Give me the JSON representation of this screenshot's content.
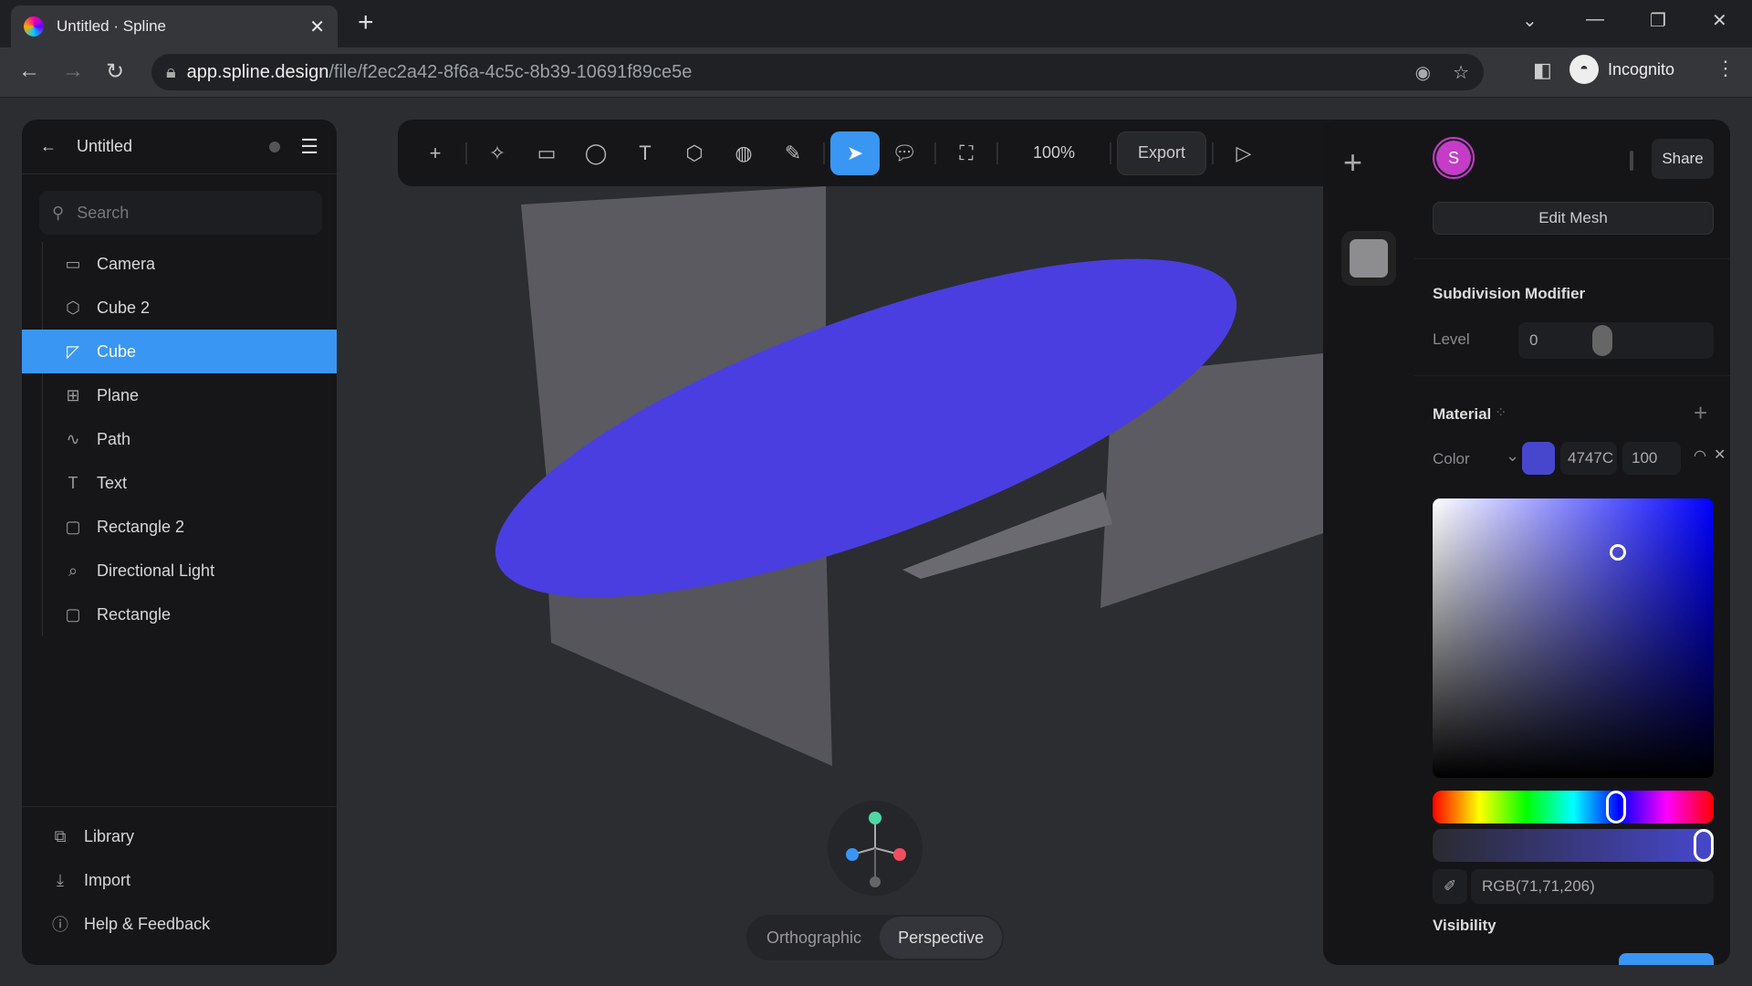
{
  "browser": {
    "tab_title": "Untitled · Spline",
    "url_host": "app.spline.design",
    "url_path": "/file/f2ec2a42-8f6a-4c5c-8b39-10691f89ce5e",
    "profile": "Incognito"
  },
  "left_panel": {
    "title": "Untitled",
    "search_placeholder": "Search",
    "items": [
      {
        "label": "Camera",
        "icon": "camera-icon"
      },
      {
        "label": "Cube 2",
        "icon": "cube-icon"
      },
      {
        "label": "Cube",
        "icon": "edit-mesh-icon",
        "selected": true
      },
      {
        "label": "Plane",
        "icon": "plane-icon"
      },
      {
        "label": "Path",
        "icon": "path-icon"
      },
      {
        "label": "Text",
        "icon": "text-icon"
      },
      {
        "label": "Rectangle 2",
        "icon": "rectangle-icon"
      },
      {
        "label": "Directional Light",
        "icon": "light-icon"
      },
      {
        "label": "Rectangle",
        "icon": "rectangle-icon"
      }
    ],
    "footer": [
      {
        "label": "Library"
      },
      {
        "label": "Import"
      },
      {
        "label": "Help & Feedback"
      }
    ]
  },
  "toolbar": {
    "zoom": "100%",
    "export": "Export"
  },
  "view": {
    "orthographic": "Orthographic",
    "perspective": "Perspective",
    "active": "Perspective"
  },
  "right_panel": {
    "avatar": "S",
    "share": "Share",
    "edit_mesh": "Edit Mesh",
    "subdivision": {
      "title": "Subdivision Modifier",
      "level_label": "Level",
      "level_value": "0"
    },
    "material": {
      "title": "Material",
      "color_label": "Color",
      "hex": "4747C",
      "opacity": "100",
      "rgb": "RGB(71,71,206)",
      "swatch": "#4747ce"
    },
    "visibility": "Visibility"
  },
  "colors": {
    "accent": "#3a96f3",
    "shape": "#4a3ee0",
    "avatar": "#c43cc8"
  }
}
